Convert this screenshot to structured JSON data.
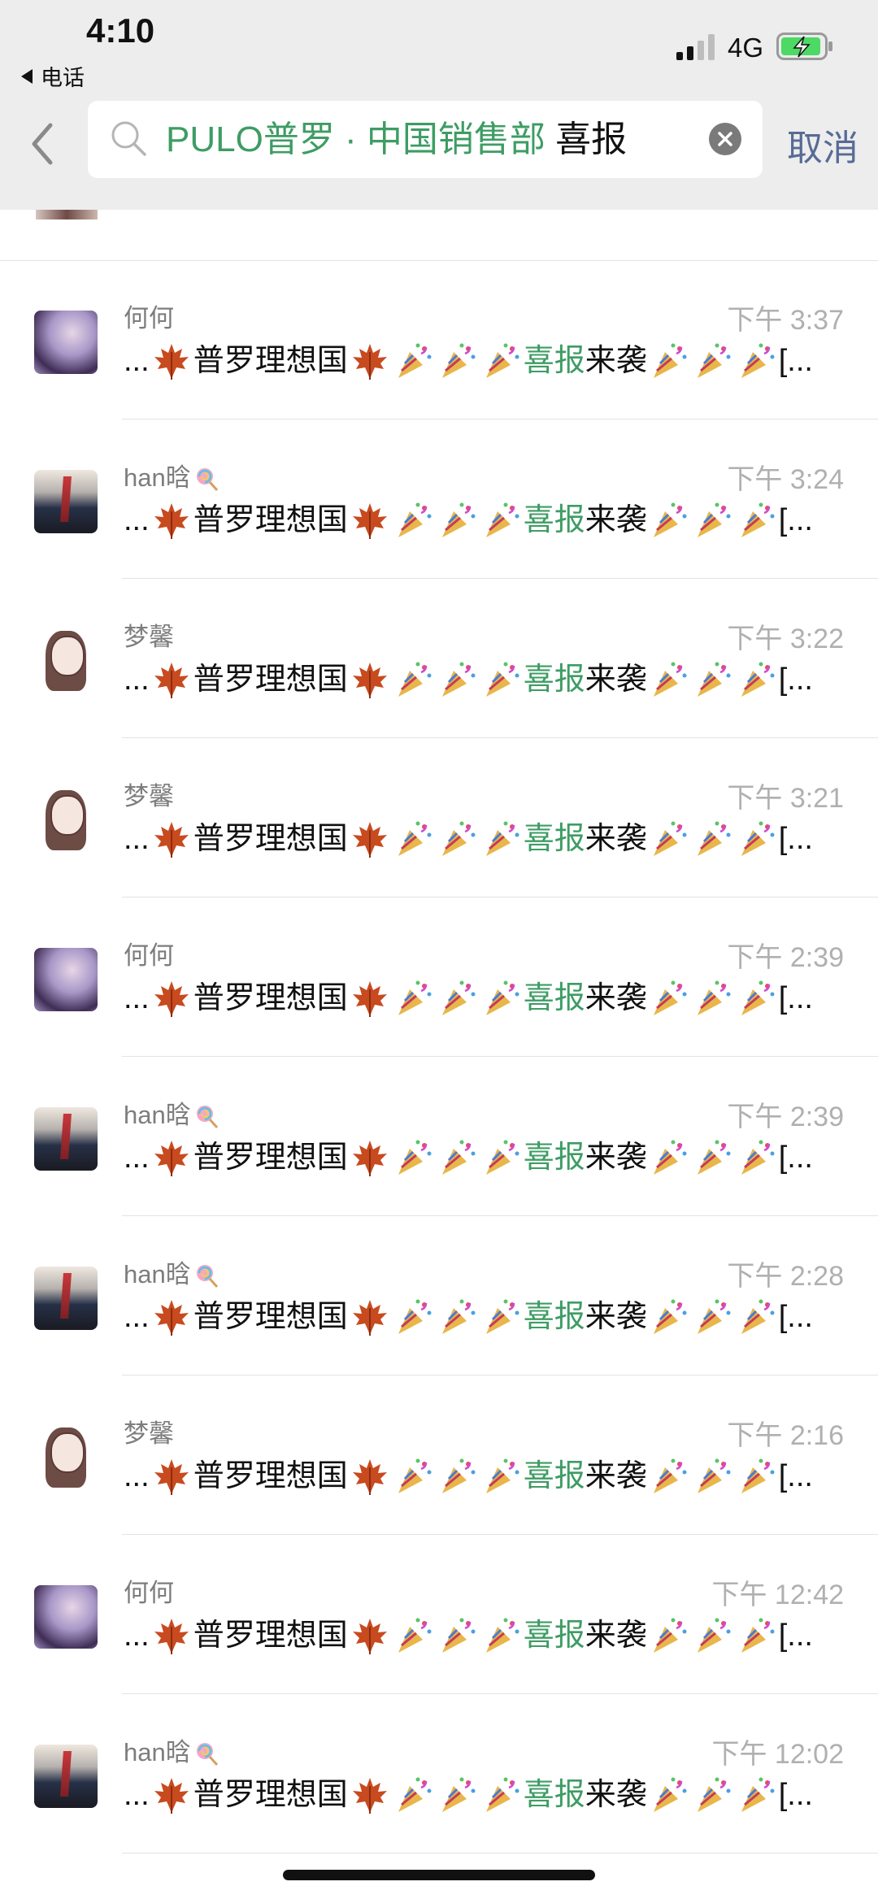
{
  "status_bar": {
    "time": "4:10",
    "back_app_label": "电话",
    "network": "4G",
    "battery_color": "#4cd964"
  },
  "search_bar": {
    "query_highlight": "PULO普罗 · 中国销售部",
    "query_rest": " 喜报",
    "clear_icon": "close-circle-icon",
    "cancel_label": "取消"
  },
  "colors": {
    "accent_green": "#3e9c64",
    "link_blue": "#576b95"
  },
  "message_parts": {
    "prefix": "...",
    "title": "普罗理想国",
    "keyword": "喜报",
    "after_keyword": "来袭",
    "suffix": "[...",
    "emoji_leaf": "maple-leaf",
    "emoji_party": "party-popper"
  },
  "results": [
    {
      "name": "何何",
      "lollipop": false,
      "time": "下午 3:37",
      "avatar": "he"
    },
    {
      "name": "han晗",
      "lollipop": true,
      "time": "下午 3:24",
      "avatar": "han"
    },
    {
      "name": "梦馨",
      "lollipop": false,
      "time": "下午 3:22",
      "avatar": "meng"
    },
    {
      "name": "梦馨",
      "lollipop": false,
      "time": "下午 3:21",
      "avatar": "meng"
    },
    {
      "name": "何何",
      "lollipop": false,
      "time": "下午 2:39",
      "avatar": "he"
    },
    {
      "name": "han晗",
      "lollipop": true,
      "time": "下午 2:39",
      "avatar": "han"
    },
    {
      "name": "han晗",
      "lollipop": true,
      "time": "下午 2:28",
      "avatar": "han"
    },
    {
      "name": "梦馨",
      "lollipop": false,
      "time": "下午 2:16",
      "avatar": "meng"
    },
    {
      "name": "何何",
      "lollipop": false,
      "time": "下午 12:42",
      "avatar": "he"
    },
    {
      "name": "han晗",
      "lollipop": true,
      "time": "下午 12:02",
      "avatar": "han"
    }
  ]
}
